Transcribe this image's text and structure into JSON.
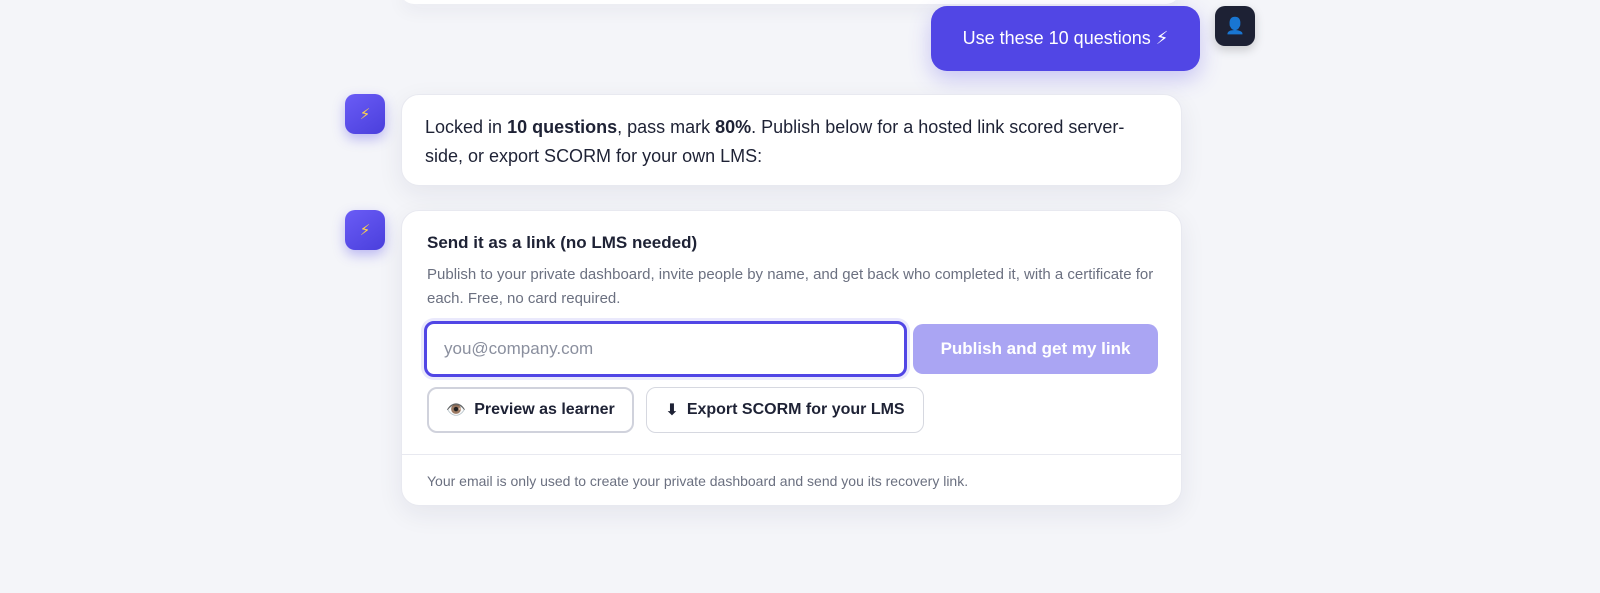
{
  "user_message": {
    "text": "Use these 10 questions ⚡",
    "avatar_icon": "👤"
  },
  "bot_avatar_icon": "⚡",
  "assistant_message": {
    "part1": "Locked in ",
    "bold1": "10 questions",
    "part2": ", pass mark ",
    "bold2": "80%",
    "part3": ". Publish below for a hosted link scored server-side, or export SCORM for your own LMS:"
  },
  "publish_card": {
    "title": "Send it as a link (no LMS needed)",
    "description": "Publish to your private dashboard, invite people by name, and get back who completed it, with a certificate for each. Free, no card required.",
    "email_placeholder": "you@company.com",
    "email_value": "",
    "publish_label": "Publish and get my link",
    "preview_icon": "👁️",
    "preview_label": "Preview as learner",
    "export_icon": "⬇",
    "export_label": "Export SCORM for your LMS",
    "footer": "Your email is only used to create your private dashboard and send you its recovery link."
  },
  "colors": {
    "accent": "#5146e5",
    "accent_disabled": "#aaa5f3",
    "background": "#f4f5f9"
  }
}
